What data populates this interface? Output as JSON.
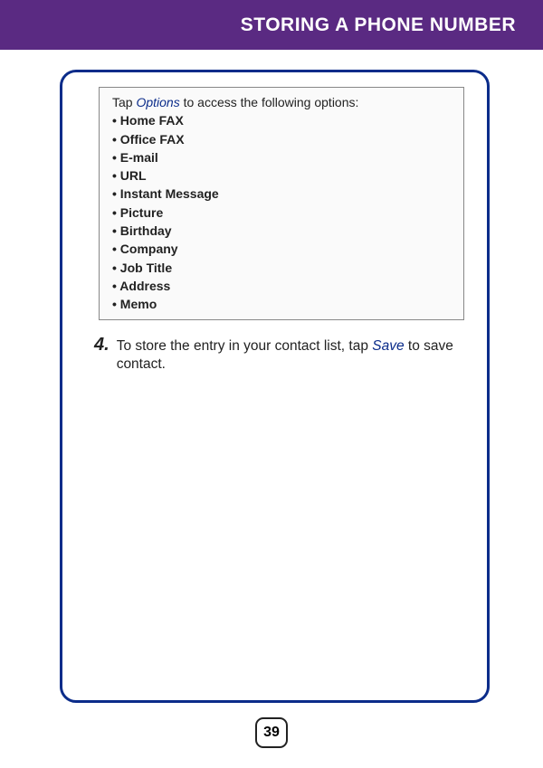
{
  "header": {
    "title": "STORING A PHONE NUMBER"
  },
  "optionsBox": {
    "intro_prefix": "Tap ",
    "intro_link": "Options",
    "intro_suffix": " to access the following options:",
    "items": [
      "Home FAX",
      "Office FAX",
      "E-mail",
      "URL",
      "Instant Message",
      "Picture",
      "Birthday",
      "Company",
      "Job Title",
      "Address",
      "Memo"
    ]
  },
  "step": {
    "number": "4.",
    "text_prefix": "To store the entry in your contact list, tap ",
    "save_link": "Save",
    "text_suffix": " to save contact."
  },
  "pageNumber": "39"
}
